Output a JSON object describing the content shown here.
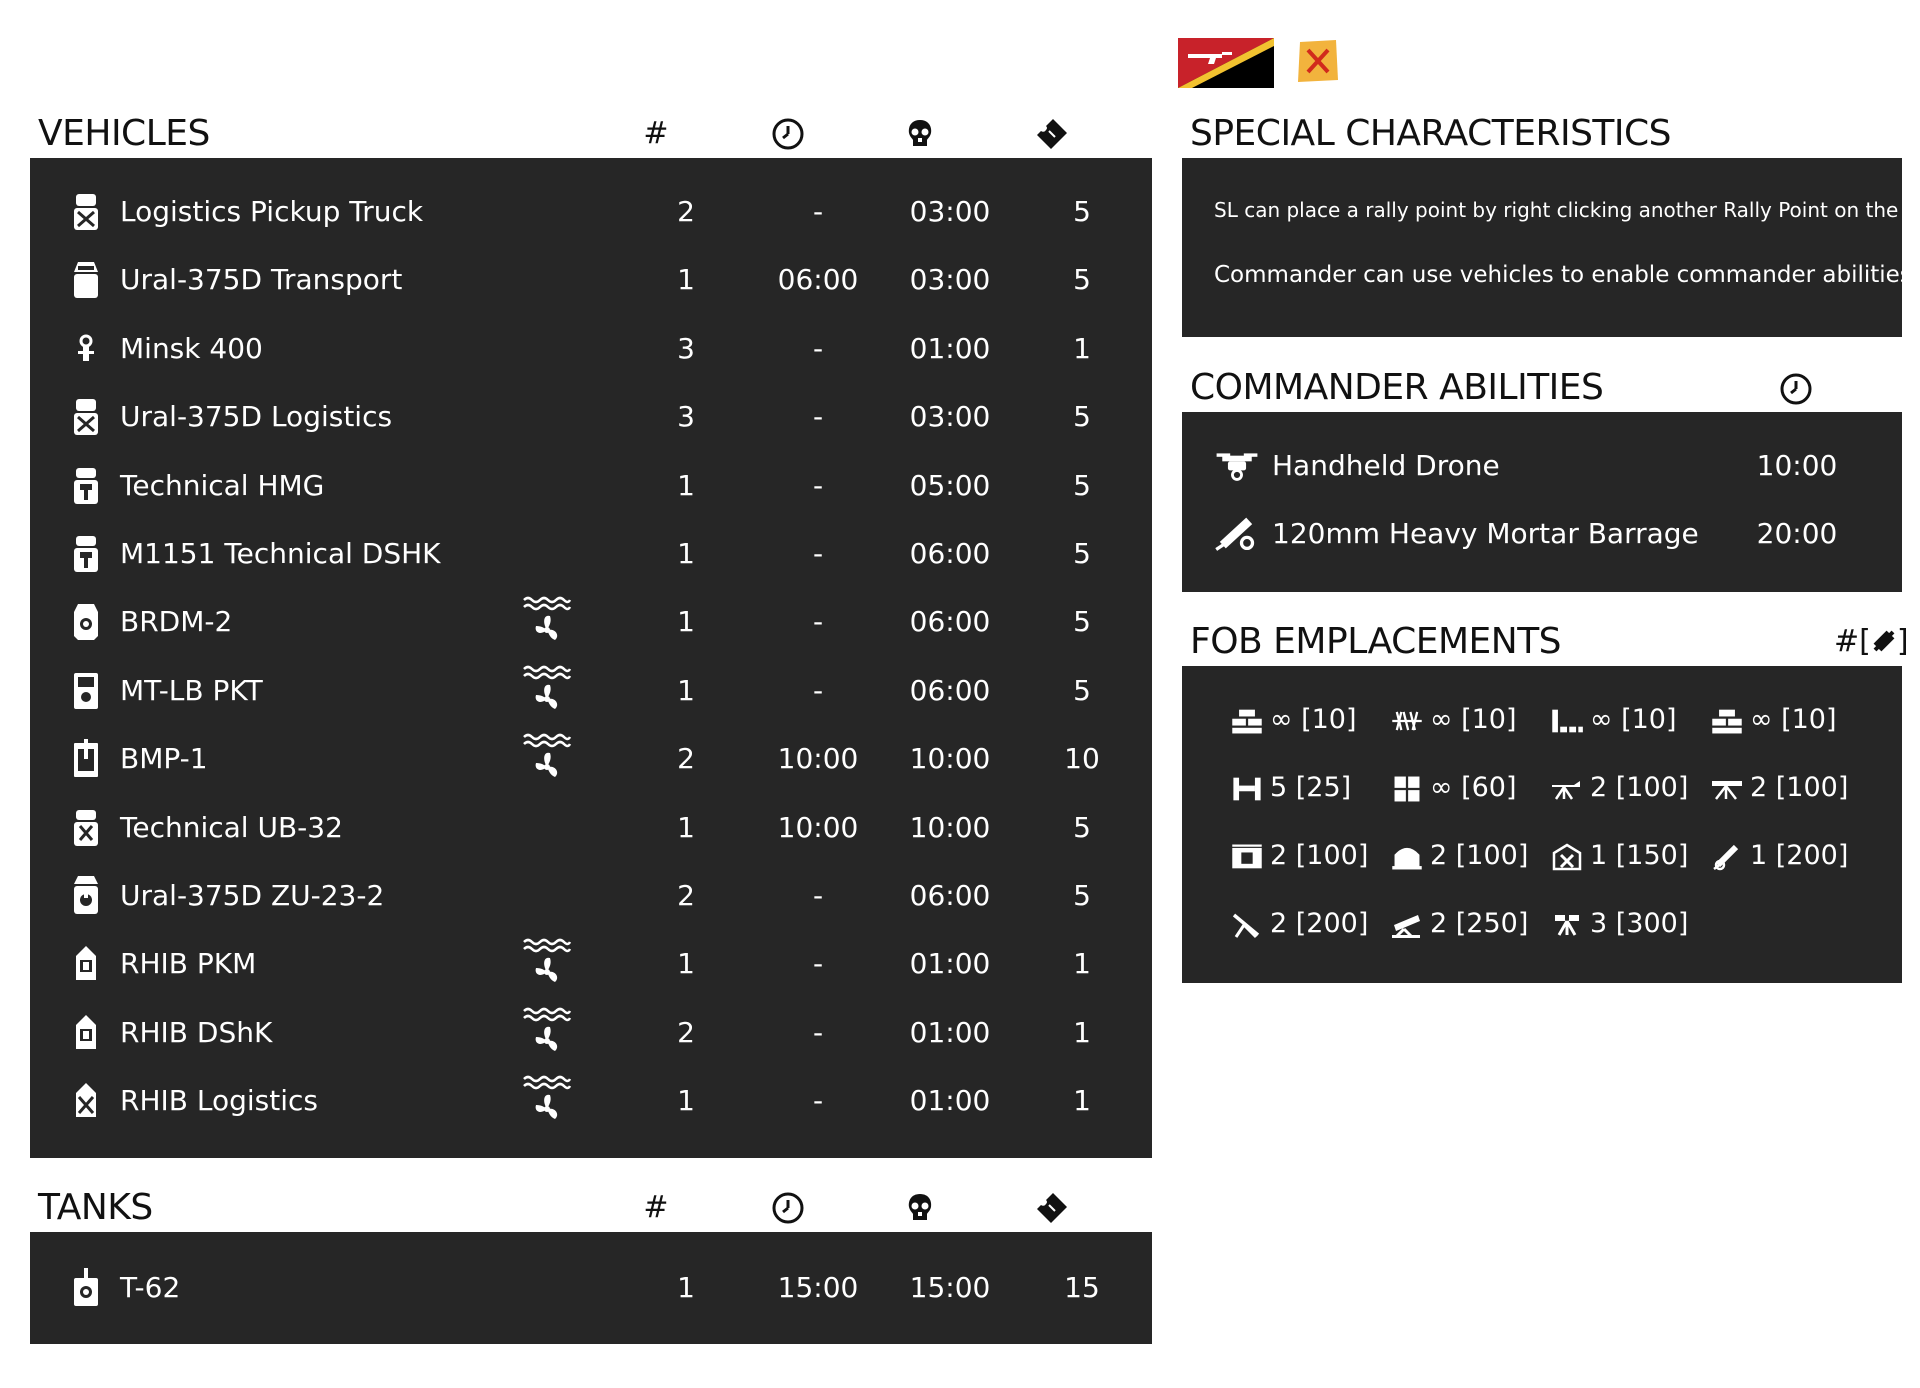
{
  "flags": [
    {
      "name": "faction-flag",
      "colors": [
        "#c8222a",
        "#000000",
        "#f2c230"
      ]
    },
    {
      "name": "subfaction-flag",
      "colors": [
        "#f2b33d",
        "#d12a1c"
      ]
    }
  ],
  "vehicles": {
    "title": "VEHICLES",
    "col_count": "#",
    "rows": [
      {
        "icon": "logistics-truck-icon",
        "name": "Logistics Pickup Truck",
        "amphibious": false,
        "count": "2",
        "delay": "-",
        "respawn": "03:00",
        "tickets": "5"
      },
      {
        "icon": "transport-truck-icon",
        "name": "Ural-375D Transport",
        "amphibious": false,
        "count": "1",
        "delay": "06:00",
        "respawn": "03:00",
        "tickets": "5"
      },
      {
        "icon": "motorcycle-icon",
        "name": "Minsk 400",
        "amphibious": false,
        "count": "3",
        "delay": "-",
        "respawn": "01:00",
        "tickets": "1"
      },
      {
        "icon": "logistics-truck-icon",
        "name": "Ural-375D Logistics",
        "amphibious": false,
        "count": "3",
        "delay": "-",
        "respawn": "03:00",
        "tickets": "5"
      },
      {
        "icon": "technical-icon",
        "name": "Technical HMG",
        "amphibious": false,
        "count": "1",
        "delay": "-",
        "respawn": "05:00",
        "tickets": "5"
      },
      {
        "icon": "technical-icon",
        "name": "M1151 Technical DSHK",
        "amphibious": false,
        "count": "1",
        "delay": "-",
        "respawn": "06:00",
        "tickets": "5"
      },
      {
        "icon": "armored-car-icon",
        "name": "BRDM-2",
        "amphibious": true,
        "count": "1",
        "delay": "-",
        "respawn": "06:00",
        "tickets": "5"
      },
      {
        "icon": "apc-icon",
        "name": "MT-LB PKT",
        "amphibious": true,
        "count": "1",
        "delay": "-",
        "respawn": "06:00",
        "tickets": "5"
      },
      {
        "icon": "ifv-icon",
        "name": "BMP-1",
        "amphibious": true,
        "count": "2",
        "delay": "10:00",
        "respawn": "10:00",
        "tickets": "10"
      },
      {
        "icon": "rocket-technical-icon",
        "name": "Technical UB-32",
        "amphibious": false,
        "count": "1",
        "delay": "10:00",
        "respawn": "10:00",
        "tickets": "5"
      },
      {
        "icon": "anti-air-truck-icon",
        "name": "Ural-375D ZU-23-2",
        "amphibious": false,
        "count": "2",
        "delay": "-",
        "respawn": "06:00",
        "tickets": "5"
      },
      {
        "icon": "boat-icon",
        "name": "RHIB PKM",
        "amphibious": true,
        "count": "1",
        "delay": "-",
        "respawn": "01:00",
        "tickets": "1"
      },
      {
        "icon": "boat-icon",
        "name": "RHIB DShK",
        "amphibious": true,
        "count": "2",
        "delay": "-",
        "respawn": "01:00",
        "tickets": "1"
      },
      {
        "icon": "logistics-boat-icon",
        "name": "RHIB Logistics",
        "amphibious": true,
        "count": "1",
        "delay": "-",
        "respawn": "01:00",
        "tickets": "1"
      }
    ]
  },
  "tanks": {
    "title": "TANKS",
    "col_count": "#",
    "rows": [
      {
        "icon": "tank-icon",
        "name": "T-62",
        "count": "1",
        "delay": "15:00",
        "respawn": "15:00",
        "tickets": "15"
      }
    ]
  },
  "special": {
    "title": "SPECIAL CHARACTERISTICS",
    "lines": [
      "SL can place a rally point by right clicking another Rally Point on the map",
      "Commander can use vehicles to enable commander abilities"
    ]
  },
  "commander": {
    "title": "COMMANDER ABILITIES",
    "abilities": [
      {
        "icon": "drone-icon",
        "name": "Handheld Drone",
        "cooldown": "10:00"
      },
      {
        "icon": "mortar-barrage-icon",
        "name": "120mm Heavy Mortar Barrage",
        "cooldown": "20:00"
      }
    ]
  },
  "fob": {
    "title": "FOB EMPLACEMENTS",
    "header_label": "#[",
    "header_suffix": "]",
    "items": [
      {
        "icon": "sandbag-wall-icon",
        "text": "∞ [10]"
      },
      {
        "icon": "razor-wire-icon",
        "text": "∞ [10]"
      },
      {
        "icon": "l-wall-icon",
        "text": "∞ [10]"
      },
      {
        "icon": "sandbag-wall-icon",
        "text": "∞ [10]"
      },
      {
        "icon": "barrier-icon",
        "text": "5 [25]"
      },
      {
        "icon": "bunker-block-icon",
        "text": "∞ [60]"
      },
      {
        "icon": "hmg-emplacement-icon",
        "text": "2 [100]"
      },
      {
        "icon": "atgm-emplacement-icon",
        "text": "2 [100]"
      },
      {
        "icon": "ammo-crate-icon",
        "text": "2 [100]"
      },
      {
        "icon": "bunker-icon",
        "text": "2 [100]"
      },
      {
        "icon": "repair-station-icon",
        "text": "1 [150]"
      },
      {
        "icon": "mortar-icon",
        "text": "1 [200]"
      },
      {
        "icon": "artillery-icon",
        "text": "2 [200]"
      },
      {
        "icon": "rocket-launcher-icon",
        "text": "2 [250]"
      },
      {
        "icon": "anti-air-gun-icon",
        "text": "3 [300]"
      }
    ]
  }
}
